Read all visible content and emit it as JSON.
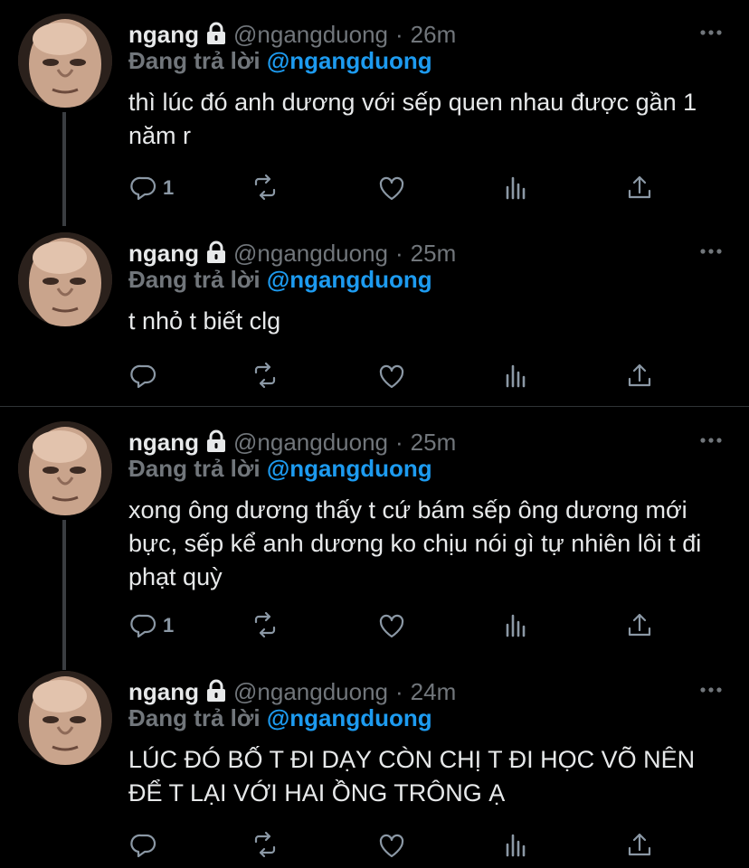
{
  "colors": {
    "background": "#000000",
    "text": "#e7e9ea",
    "muted": "#71767b",
    "accent": "#1d9bf0",
    "icon": "#8b98a5"
  },
  "icons": {
    "lock": "lock-icon",
    "more": "more-icon",
    "reply": "reply-icon",
    "retweet": "retweet-icon",
    "like": "like-icon",
    "views": "views-icon",
    "share": "share-icon"
  },
  "tweets": [
    {
      "name": "ngang",
      "handle": "@ngangduong",
      "separator": "·",
      "time": "26m",
      "replying_prefix": "Đang trả lời",
      "replying_to": "@ngangduong",
      "text": "thì lúc đó anh dương với sếp quen nhau được gần 1 năm r",
      "reply_count": "1"
    },
    {
      "name": "ngang",
      "handle": "@ngangduong",
      "separator": "·",
      "time": "25m",
      "replying_prefix": "Đang trả lời",
      "replying_to": "@ngangduong",
      "text": "t nhỏ t biết clg",
      "reply_count": ""
    },
    {
      "name": "ngang",
      "handle": "@ngangduong",
      "separator": "·",
      "time": "25m",
      "replying_prefix": "Đang trả lời",
      "replying_to": "@ngangduong",
      "text": "xong ông dương thấy t cứ bám sếp ông dương mới bực, sếp kể anh dương ko chịu nói gì tự nhiên lôi t đi phạt quỳ",
      "reply_count": "1"
    },
    {
      "name": "ngang",
      "handle": "@ngangduong",
      "separator": "·",
      "time": "24m",
      "replying_prefix": "Đang trả lời",
      "replying_to": "@ngangduong",
      "text": "LÚC ĐÓ BỐ T ĐI DẠY CÒN CHỊ T ĐI HỌC VÕ NÊN ĐỂ T LẠI VỚI HAI ỒNG TRÔNG Ạ",
      "reply_count": ""
    }
  ]
}
